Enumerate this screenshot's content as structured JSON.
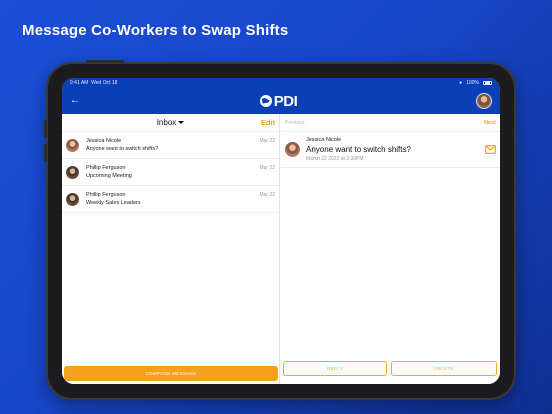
{
  "promo": {
    "title": "Message Co-Workers to Swap Shifts"
  },
  "statusbar": {
    "time": "9:41 AM",
    "date": "Wed Oct 18",
    "battery": "100%"
  },
  "navbar": {
    "logo_text": "PDI",
    "back_icon": "back-arrow-icon",
    "avatar_icon": "user-avatar"
  },
  "inbox": {
    "label": "Inbox",
    "edit_label": "Edit",
    "messages": [
      {
        "sender": "Jessica Nicole",
        "preview": "Anyone want to switch shifts?",
        "date": "Mar 22"
      },
      {
        "sender": "Phillip Ferguson",
        "preview": "Upcoming Meeting",
        "date": "Mar 22"
      },
      {
        "sender": "Phillip Ferguson",
        "preview": "Weekly Sales Leaders",
        "date": "Mar 22"
      }
    ],
    "compose_label": "COMPOSE MESSAGE"
  },
  "detail": {
    "previous_label": "Previous",
    "next_label": "Next",
    "sender": "Jessica Nicole",
    "subject": "Anyone want to switch shifts?",
    "date": "March 22 2022 at 2:30PM",
    "mail_icon": "envelope-icon",
    "reply_label": "REPLY",
    "delete_label": "DELETE"
  },
  "colors": {
    "brand_blue": "#0a3fb8",
    "accent_orange": "#f5a623"
  }
}
